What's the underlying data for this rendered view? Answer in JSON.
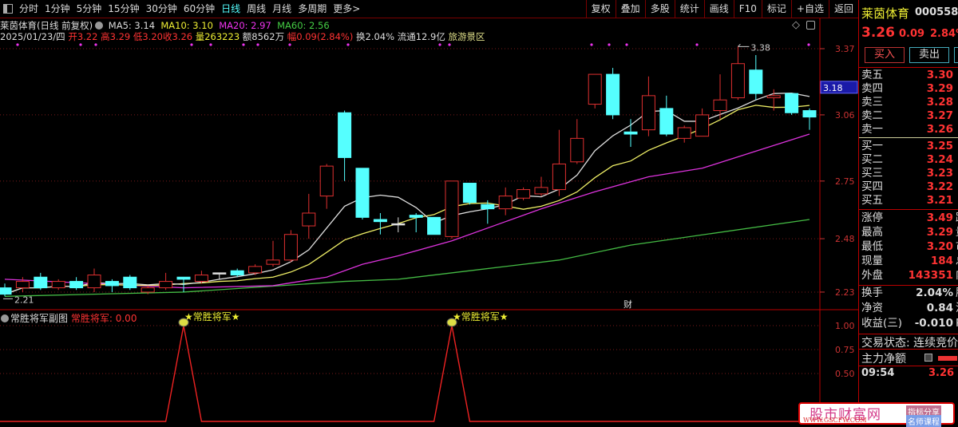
{
  "toolbar": {
    "periods": [
      "分时",
      "1分钟",
      "5分钟",
      "15分钟",
      "30分钟",
      "60分钟",
      "日线",
      "周线",
      "月线",
      "多周期",
      "更多>"
    ],
    "active_period": "日线",
    "tools": [
      "复权",
      "叠加",
      "多股",
      "统计",
      "画线",
      "F10",
      "标记",
      "+自选",
      "返回"
    ]
  },
  "info": {
    "title": "莱茵体育(日线 前复权)",
    "ma5": "MA5: 3.14",
    "ma10": "MA10: 3.10",
    "ma20": "MA20: 2.97",
    "ma60": "MA60: 2.56",
    "date": "2025/01/23/四",
    "open_label": "开",
    "open": "3.22",
    "high_label": "高",
    "high": "3.29",
    "low_label": "低",
    "low": "3.20",
    "close_label": "收",
    "close": "3.26",
    "vol_label": "量",
    "vol": "263223",
    "amount": "额8562万",
    "range_label": "幅",
    "range": "0.09(2.84%)",
    "turnover": "换2.04%",
    "float": "流通12.9亿",
    "sector": "旅游景区"
  },
  "colors": {
    "up": "#e03030",
    "down": "#55ffff",
    "ma5": "#dddddd",
    "ma10": "#eeee66",
    "ma20": "#dd33dd",
    "ma60": "#44bb44",
    "axis": "#cc3333",
    "indicator": "#ee2222"
  },
  "chart_data": [
    {
      "type": "candlestick",
      "price_axis": {
        "ticks": [
          "3.37",
          "3.06",
          "2.75",
          "2.48",
          "2.23"
        ],
        "range": [
          2.2,
          3.4
        ],
        "grid": true
      },
      "marker_price": "3.18",
      "max_label": "3.38",
      "min_label": "2.21",
      "event_marker": "财",
      "candles": [
        [
          2.25,
          2.27,
          2.21,
          2.22
        ],
        [
          2.25,
          2.3,
          2.23,
          2.28
        ],
        [
          2.3,
          2.32,
          2.24,
          2.25
        ],
        [
          2.25,
          2.29,
          2.24,
          2.28
        ],
        [
          2.28,
          2.3,
          2.24,
          2.25
        ],
        [
          2.25,
          2.34,
          2.23,
          2.31
        ],
        [
          2.28,
          2.29,
          2.23,
          2.26
        ],
        [
          2.3,
          2.31,
          2.24,
          2.25
        ],
        [
          2.23,
          2.26,
          2.22,
          2.25
        ],
        [
          2.25,
          2.32,
          2.24,
          2.28
        ],
        [
          2.3,
          2.3,
          2.23,
          2.29
        ],
        [
          2.28,
          2.33,
          2.27,
          2.31
        ],
        [
          2.32,
          2.32,
          2.29,
          2.32
        ],
        [
          2.33,
          2.34,
          2.3,
          2.31
        ],
        [
          2.32,
          2.36,
          2.31,
          2.35
        ],
        [
          2.36,
          2.47,
          2.35,
          2.38
        ],
        [
          2.38,
          2.52,
          2.37,
          2.5
        ],
        [
          2.54,
          2.69,
          2.48,
          2.6
        ],
        [
          2.68,
          2.83,
          2.62,
          2.82
        ],
        [
          3.07,
          3.08,
          2.75,
          2.86
        ],
        [
          2.81,
          2.81,
          2.57,
          2.58
        ],
        [
          2.57,
          2.6,
          2.5,
          2.56
        ],
        [
          2.55,
          2.58,
          2.51,
          2.55
        ],
        [
          2.59,
          2.6,
          2.51,
          2.58
        ],
        [
          2.58,
          2.58,
          2.5,
          2.5
        ],
        [
          2.49,
          2.75,
          2.48,
          2.75
        ],
        [
          2.74,
          2.74,
          2.64,
          2.65
        ],
        [
          2.64,
          2.66,
          2.55,
          2.62
        ],
        [
          2.62,
          2.72,
          2.59,
          2.68
        ],
        [
          2.67,
          2.72,
          2.66,
          2.71
        ],
        [
          2.69,
          2.77,
          2.68,
          2.72
        ],
        [
          2.71,
          2.99,
          2.68,
          2.83
        ],
        [
          2.84,
          3.04,
          2.83,
          2.95
        ],
        [
          3.11,
          3.25,
          3.09,
          3.25
        ],
        [
          3.25,
          3.28,
          3.04,
          3.06
        ],
        [
          2.98,
          3.04,
          2.91,
          2.97
        ],
        [
          2.99,
          3.24,
          2.96,
          3.15
        ],
        [
          3.09,
          3.15,
          2.96,
          2.97
        ],
        [
          2.95,
          3.01,
          2.93,
          3.0
        ],
        [
          2.96,
          3.09,
          2.96,
          3.06
        ],
        [
          3.08,
          3.25,
          3.04,
          3.13
        ],
        [
          3.14,
          3.38,
          3.13,
          3.3
        ],
        [
          3.27,
          3.34,
          3.13,
          3.16
        ],
        [
          3.14,
          3.18,
          3.08,
          3.15
        ],
        [
          3.16,
          3.16,
          3.06,
          3.07
        ],
        [
          3.08,
          3.09,
          2.99,
          3.05
        ]
      ],
      "ma20": [
        [
          0,
          2.29
        ],
        [
          5,
          2.27
        ],
        [
          10,
          2.25
        ],
        [
          15,
          2.26
        ],
        [
          18,
          2.3
        ],
        [
          20,
          2.36
        ],
        [
          22,
          2.4
        ],
        [
          25,
          2.47
        ],
        [
          28,
          2.56
        ],
        [
          30,
          2.62
        ],
        [
          33,
          2.7
        ],
        [
          36,
          2.77
        ],
        [
          39,
          2.81
        ],
        [
          42,
          2.89
        ],
        [
          45,
          2.97
        ]
      ],
      "ma60": [
        [
          0,
          2.21
        ],
        [
          10,
          2.23
        ],
        [
          19,
          2.28
        ],
        [
          22,
          2.29
        ],
        [
          26,
          2.33
        ],
        [
          31,
          2.38
        ],
        [
          35,
          2.45
        ],
        [
          45,
          2.57
        ]
      ]
    },
    {
      "type": "line",
      "title": "常胜将军副图",
      "series_name": "常胜将军",
      "current_value": "0.00",
      "y_ticks": [
        "1.00",
        "0.75",
        "0.50"
      ],
      "signal_label": "★常胜将军★",
      "signal_indices": [
        10,
        25
      ],
      "values": [
        0,
        0,
        0,
        0,
        0,
        0,
        0,
        0,
        0,
        0,
        1,
        0,
        0,
        0,
        0,
        0,
        0,
        0,
        0,
        0,
        0,
        0,
        0,
        0,
        0,
        1,
        0,
        0,
        0,
        0,
        0,
        0,
        0,
        0,
        0,
        0,
        0,
        0,
        0,
        0,
        0,
        0,
        0,
        0,
        0,
        0
      ]
    }
  ],
  "quote": {
    "name": "莱茵体育",
    "code": "000558",
    "price": "3.26",
    "change": "0.09",
    "pct": "2.84%",
    "buy_btn": "买入",
    "sell_btn": "卖出",
    "asks": [
      {
        "label": "卖五",
        "price": "3.30"
      },
      {
        "label": "卖四",
        "price": "3.29"
      },
      {
        "label": "卖三",
        "price": "3.28"
      },
      {
        "label": "卖二",
        "price": "3.27"
      },
      {
        "label": "卖一",
        "price": "3.26"
      }
    ],
    "bids": [
      {
        "label": "买一",
        "price": "3.25"
      },
      {
        "label": "买二",
        "price": "3.24"
      },
      {
        "label": "买三",
        "price": "3.23"
      },
      {
        "label": "买四",
        "price": "3.22"
      },
      {
        "label": "买五",
        "price": "3.21"
      }
    ],
    "stats": [
      {
        "label": "涨停",
        "value": "3.49",
        "cut": "跌"
      },
      {
        "label": "最高",
        "value": "3.29",
        "cut": "量"
      },
      {
        "label": "最低",
        "value": "3.20",
        "cut": "市"
      },
      {
        "label": "现量",
        "value": "184",
        "cut": "总"
      },
      {
        "label": "外盘",
        "value": "143351",
        "cut": "内"
      }
    ],
    "fund": [
      {
        "label": "换手",
        "value": "2.04%",
        "cut": "股"
      },
      {
        "label": "净资",
        "value": "0.84",
        "cut": "流"
      },
      {
        "label": "收益(三)",
        "value": "-0.010",
        "cut": "P"
      }
    ],
    "status": "交易状态: 连续竞价",
    "main_flow": "主力净额",
    "tick_time": "09:54",
    "tick_price": "3.26"
  },
  "watermark": {
    "name": "股市财富网",
    "url": "WWW.GSCFW.COM",
    "tag1": "指标分享",
    "tag2": "名师课程"
  }
}
